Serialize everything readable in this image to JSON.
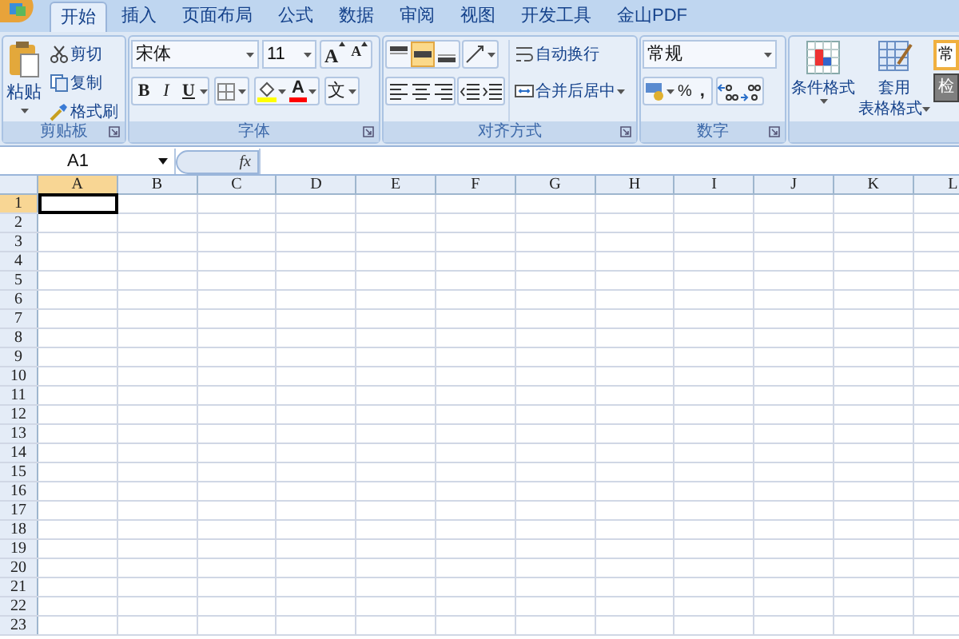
{
  "tabs": [
    {
      "label": "开始",
      "selected": true
    },
    {
      "label": "插入",
      "selected": false
    },
    {
      "label": "页面布局",
      "selected": false
    },
    {
      "label": "公式",
      "selected": false
    },
    {
      "label": "数据",
      "selected": false
    },
    {
      "label": "审阅",
      "selected": false
    },
    {
      "label": "视图",
      "selected": false
    },
    {
      "label": "开发工具",
      "selected": false
    },
    {
      "label": "金山PDF",
      "selected": false
    }
  ],
  "clipboard": {
    "label": "剪贴板",
    "paste": "粘贴",
    "cut": "剪切",
    "copy": "复制",
    "format_painter": "格式刷"
  },
  "font": {
    "label": "字体",
    "font_name": "宋体",
    "font_size": "11",
    "grow": "A",
    "shrink": "A",
    "bold": "B",
    "italic": "I",
    "underline": "U",
    "font_color": "A",
    "phonetic": "文"
  },
  "alignment": {
    "label": "对齐方式",
    "vertical": [
      {
        "selected": false
      },
      {
        "selected": true
      },
      {
        "selected": false
      }
    ],
    "wrap_text": "自动换行",
    "merge_center": "合并后居中"
  },
  "number": {
    "label": "数字",
    "format": "常规",
    "percent": "%",
    "comma": ","
  },
  "styles": {
    "conditional_formatting": "条件格式",
    "format_as_table": [
      "套用",
      "表格格式"
    ],
    "cell_styles": [
      "常",
      "检"
    ]
  },
  "formula_bar": {
    "name_box": "A1",
    "fx": "fx"
  },
  "columns": [
    {
      "label": "A",
      "selected": true
    },
    {
      "label": "B",
      "selected": false
    },
    {
      "label": "C",
      "selected": false
    },
    {
      "label": "D",
      "selected": false
    },
    {
      "label": "E",
      "selected": false
    },
    {
      "label": "F",
      "selected": false
    },
    {
      "label": "G",
      "selected": false
    },
    {
      "label": "H",
      "selected": false
    },
    {
      "label": "I",
      "selected": false
    },
    {
      "label": "J",
      "selected": false
    },
    {
      "label": "K",
      "selected": false
    },
    {
      "label": "L",
      "selected": false
    }
  ],
  "rows": [
    {
      "label": "1",
      "selected": true
    },
    {
      "label": "2",
      "selected": false
    },
    {
      "label": "3",
      "selected": false
    },
    {
      "label": "4",
      "selected": false
    },
    {
      "label": "5",
      "selected": false
    },
    {
      "label": "6",
      "selected": false
    },
    {
      "label": "7",
      "selected": false
    },
    {
      "label": "8",
      "selected": false
    },
    {
      "label": "9",
      "selected": false
    },
    {
      "label": "10",
      "selected": false
    },
    {
      "label": "11",
      "selected": false
    },
    {
      "label": "12",
      "selected": false
    },
    {
      "label": "13",
      "selected": false
    },
    {
      "label": "14",
      "selected": false
    },
    {
      "label": "15",
      "selected": false
    },
    {
      "label": "16",
      "selected": false
    },
    {
      "label": "17",
      "selected": false
    },
    {
      "label": "18",
      "selected": false
    },
    {
      "label": "19",
      "selected": false
    },
    {
      "label": "20",
      "selected": false
    },
    {
      "label": "21",
      "selected": false
    },
    {
      "label": "22",
      "selected": false
    },
    {
      "label": "23",
      "selected": false
    }
  ]
}
